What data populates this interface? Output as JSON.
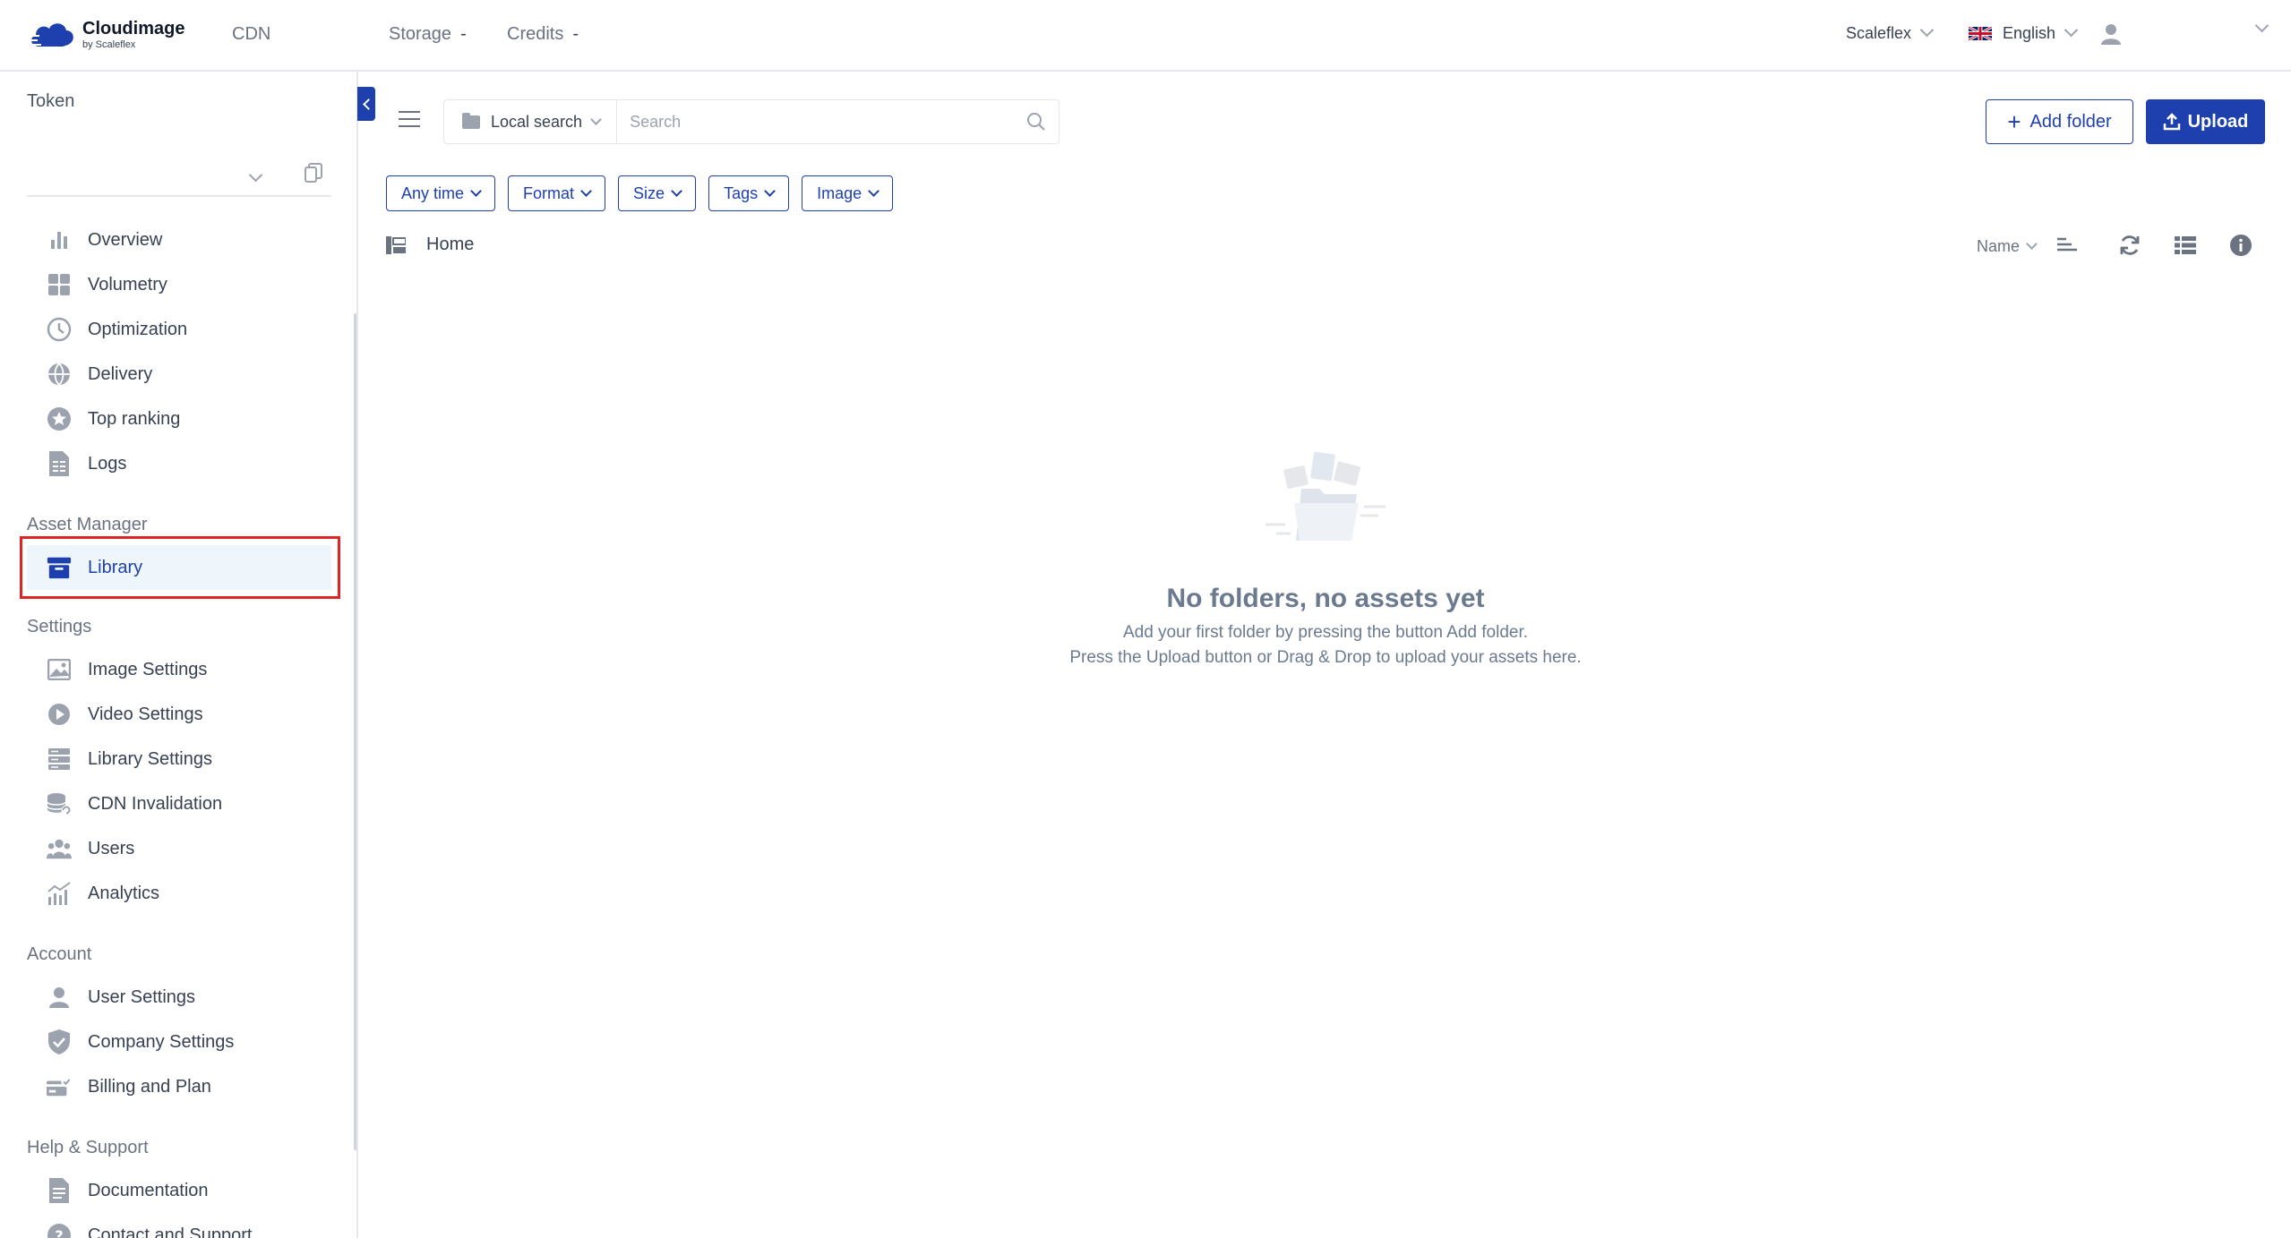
{
  "brand": {
    "name": "Cloudimage",
    "subtitle": "by Scaleflex"
  },
  "topnav": {
    "cdn": "CDN",
    "storage": "Storage",
    "storage_value": "-",
    "credits": "Credits",
    "credits_value": "-"
  },
  "topbar_right": {
    "company": "Scaleflex",
    "language": "English"
  },
  "sidebar": {
    "token_label": "Token",
    "items_cdn": [
      {
        "label": "Overview",
        "icon": "bar-chart-icon"
      },
      {
        "label": "Volumetry",
        "icon": "grid-icon"
      },
      {
        "label": "Optimization",
        "icon": "clock-icon"
      },
      {
        "label": "Delivery",
        "icon": "globe-icon"
      },
      {
        "label": "Top ranking",
        "icon": "star-icon"
      },
      {
        "label": "Logs",
        "icon": "document-icon"
      }
    ],
    "section_asset": "Asset Manager",
    "item_library": "Library",
    "section_settings": "Settings",
    "items_settings": [
      {
        "label": "Image Settings",
        "icon": "image-icon"
      },
      {
        "label": "Video Settings",
        "icon": "play-icon"
      },
      {
        "label": "Library Settings",
        "icon": "server-icon"
      },
      {
        "label": "CDN Invalidation",
        "icon": "database-icon"
      },
      {
        "label": "Users",
        "icon": "users-icon"
      },
      {
        "label": "Analytics",
        "icon": "analytics-icon"
      }
    ],
    "section_account": "Account",
    "items_account": [
      {
        "label": "User Settings",
        "icon": "user-icon"
      },
      {
        "label": "Company Settings",
        "icon": "shield-icon"
      },
      {
        "label": "Billing and Plan",
        "icon": "billing-icon"
      }
    ],
    "section_help": "Help & Support",
    "items_help": [
      {
        "label": "Documentation",
        "icon": "book-icon"
      },
      {
        "label": "Contact and Support",
        "icon": "help-icon"
      }
    ]
  },
  "toolbar": {
    "search_scope": "Local search",
    "search_placeholder": "Search",
    "add_folder": "Add folder",
    "upload": "Upload"
  },
  "filters": [
    "Any time",
    "Format",
    "Size",
    "Tags",
    "Image"
  ],
  "breadcrumb": {
    "home": "Home"
  },
  "sort": {
    "label": "Name"
  },
  "empty_state": {
    "title": "No folders, no assets yet",
    "line1": "Add your first folder by pressing the button Add folder.",
    "line2": "Press the Upload button or Drag & Drop to upload your assets here."
  },
  "colors": {
    "accent": "#1e40af",
    "highlight": "#dc2626",
    "active_bg": "#eef6fb"
  }
}
